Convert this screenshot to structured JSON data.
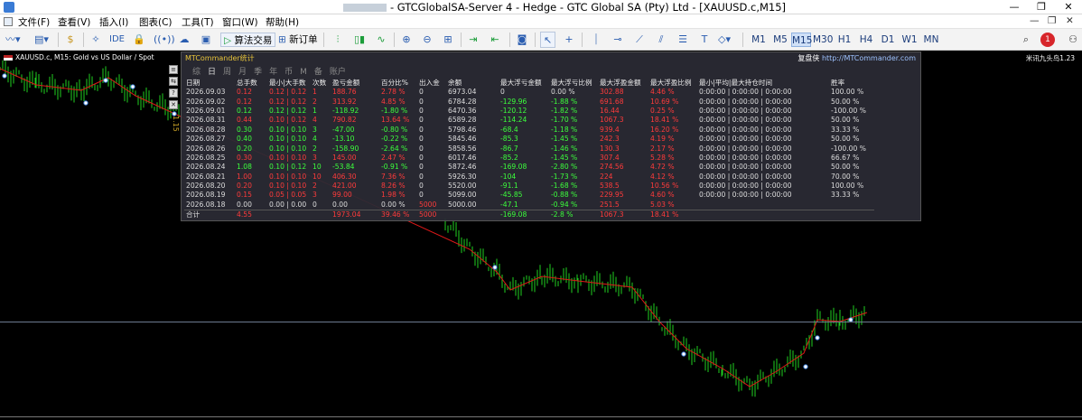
{
  "window": {
    "title": "- GTCGlobalSA-Server 4 - Hedge - GTC Global SA (Pty) Ltd - [XAUUSD.c,M15]",
    "minimize": "—",
    "restore": "❐",
    "close": "✕"
  },
  "menu": [
    {
      "name": "menu-file",
      "label": "文件(F)"
    },
    {
      "name": "menu-view",
      "label": "查看(V)"
    },
    {
      "name": "menu-insert",
      "label": "插入(I)"
    },
    {
      "name": "menu-charts",
      "label": "图表(C)"
    },
    {
      "name": "menu-tools",
      "label": "工具(T)"
    },
    {
      "name": "menu-window",
      "label": "窗口(W)"
    },
    {
      "name": "menu-help",
      "label": "帮助(H)"
    }
  ],
  "toolbar": {
    "ide": "IDE",
    "algo_trading": "算法交易",
    "new_order": "新订单",
    "timeframes": [
      "M1",
      "M5",
      "M15",
      "M30",
      "H1",
      "H4",
      "D1",
      "W1",
      "MN"
    ],
    "active_timeframe": "M15",
    "notification_count": "1"
  },
  "chart": {
    "header": "XAUUSD.c, M15:  Gold vs US Dollar / Spot",
    "right_label": "米讯九头鸟1.23",
    "price_tag": "1.15"
  },
  "colors": {
    "red": "#ff3b3b",
    "green": "#3cff3c",
    "panel_bg": "#2a2a34",
    "title_yellow": "#e8c53a",
    "candle_up": "#1fd01f",
    "ma_line": "#e01818"
  },
  "panel": {
    "title": "MTCommander统计",
    "link_label": "复盘侠",
    "link_url": "http://MTCommander.com",
    "periods": [
      "综",
      "日",
      "周",
      "月",
      "季",
      "年",
      "币",
      "M",
      "备",
      "账户"
    ],
    "selected_period": "日",
    "columns": [
      "日期",
      "总手数",
      "最小|大手数",
      "次数",
      "盈亏金额",
      "百分比%",
      "出入金",
      "余额",
      "最大浮亏金额",
      "最大浮亏比例",
      "最大浮盈金额",
      "最大浮盈比例",
      "最小|平均|最大持仓时间",
      "胜率"
    ],
    "rows": [
      {
        "cells": [
          "2026.09.03",
          "0.12",
          "0.12 | 0.12",
          "1",
          "188.76",
          "2.78 %",
          "0",
          "6973.04",
          "0",
          "0.00 %",
          "302.88",
          "4.46 %",
          "0:00:00 | 0:00:00 | 0:00:00",
          "100.00 %"
        ],
        "colors": [
          "",
          "red",
          "red",
          "red",
          "red",
          "red",
          "",
          "",
          "",
          "",
          "red",
          "red",
          "",
          ""
        ]
      },
      {
        "cells": [
          "2026.09.02",
          "0.12",
          "0.12 | 0.12",
          "2",
          "313.92",
          "4.85 %",
          "0",
          "6784.28",
          "-129.96",
          "-1.88 %",
          "691.68",
          "10.69 %",
          "0:00:00 | 0:00:00 | 0:00:00",
          "50.00 %"
        ],
        "colors": [
          "",
          "red",
          "red",
          "red",
          "red",
          "red",
          "",
          "",
          "green",
          "green",
          "red",
          "red",
          "",
          ""
        ]
      },
      {
        "cells": [
          "2026.09.01",
          "0.12",
          "0.12 | 0.12",
          "1",
          "-118.92",
          "-1.80 %",
          "0",
          "6470.36",
          "-120.12",
          "-1.82 %",
          "16.44",
          "0.25 %",
          "0:00:00 | 0:00:00 | 0:00:00",
          "-100.00 %"
        ],
        "colors": [
          "",
          "green",
          "green",
          "green",
          "green",
          "green",
          "",
          "",
          "green",
          "green",
          "red",
          "red",
          "",
          ""
        ]
      },
      {
        "cells": [
          "2026.08.31",
          "0.44",
          "0.10 | 0.12",
          "4",
          "790.82",
          "13.64 %",
          "0",
          "6589.28",
          "-114.24",
          "-1.70 %",
          "1067.3",
          "18.41 %",
          "0:00:00 | 0:00:00 | 0:00:00",
          "50.00 %"
        ],
        "colors": [
          "",
          "red",
          "red",
          "red",
          "red",
          "red",
          "",
          "",
          "green",
          "green",
          "red",
          "red",
          "",
          ""
        ]
      },
      {
        "cells": [
          "2026.08.28",
          "0.30",
          "0.10 | 0.10",
          "3",
          "-47.00",
          "-0.80 %",
          "0",
          "5798.46",
          "-68.4",
          "-1.18 %",
          "939.4",
          "16.20 %",
          "0:00:00 | 0:00:00 | 0:00:00",
          "33.33 %"
        ],
        "colors": [
          "",
          "green",
          "green",
          "green",
          "green",
          "green",
          "",
          "",
          "green",
          "green",
          "red",
          "red",
          "",
          ""
        ]
      },
      {
        "cells": [
          "2026.08.27",
          "0.40",
          "0.10 | 0.10",
          "4",
          "-13.10",
          "-0.22 %",
          "0",
          "5845.46",
          "-85.3",
          "-1.45 %",
          "242.3",
          "4.19 %",
          "0:00:00 | 0:00:00 | 0:00:00",
          "50.00 %"
        ],
        "colors": [
          "",
          "green",
          "green",
          "green",
          "green",
          "green",
          "",
          "",
          "green",
          "green",
          "red",
          "red",
          "",
          ""
        ]
      },
      {
        "cells": [
          "2026.08.26",
          "0.20",
          "0.10 | 0.10",
          "2",
          "-158.90",
          "-2.64 %",
          "0",
          "5858.56",
          "-86.7",
          "-1.46 %",
          "130.3",
          "2.17 %",
          "0:00:00 | 0:00:00 | 0:00:00",
          "-100.00 %"
        ],
        "colors": [
          "",
          "green",
          "green",
          "green",
          "green",
          "green",
          "",
          "",
          "green",
          "green",
          "red",
          "red",
          "",
          ""
        ]
      },
      {
        "cells": [
          "2026.08.25",
          "0.30",
          "0.10 | 0.10",
          "3",
          "145.00",
          "2.47 %",
          "0",
          "6017.46",
          "-85.2",
          "-1.45 %",
          "307.4",
          "5.28 %",
          "0:00:00 | 0:00:00 | 0:00:00",
          "66.67 %"
        ],
        "colors": [
          "",
          "red",
          "red",
          "red",
          "red",
          "red",
          "",
          "",
          "green",
          "green",
          "red",
          "red",
          "",
          ""
        ]
      },
      {
        "cells": [
          "2026.08.24",
          "1.08",
          "0.10 | 0.12",
          "10",
          "-53.84",
          "-0.91 %",
          "0",
          "5872.46",
          "-169.08",
          "-2.80 %",
          "274.56",
          "4.72 %",
          "0:00:00 | 0:00:00 | 0:00:00",
          "50.00 %"
        ],
        "colors": [
          "",
          "green",
          "green",
          "green",
          "green",
          "green",
          "",
          "",
          "green",
          "green",
          "red",
          "red",
          "",
          ""
        ]
      },
      {
        "cells": [
          "2026.08.21",
          "1.00",
          "0.10 | 0.10",
          "10",
          "406.30",
          "7.36 %",
          "0",
          "5926.30",
          "-104",
          "-1.73 %",
          "224",
          "4.12 %",
          "0:00:00 | 0:00:00 | 0:00:00",
          "70.00 %"
        ],
        "colors": [
          "",
          "red",
          "red",
          "red",
          "red",
          "red",
          "",
          "",
          "green",
          "green",
          "red",
          "red",
          "",
          ""
        ]
      },
      {
        "cells": [
          "2026.08.20",
          "0.20",
          "0.10 | 0.10",
          "2",
          "421.00",
          "8.26 %",
          "0",
          "5520.00",
          "-91.1",
          "-1.68 %",
          "538.5",
          "10.56 %",
          "0:00:00 | 0:00:00 | 0:00:00",
          "100.00 %"
        ],
        "colors": [
          "",
          "red",
          "red",
          "red",
          "red",
          "red",
          "",
          "",
          "green",
          "green",
          "red",
          "red",
          "",
          ""
        ]
      },
      {
        "cells": [
          "2026.08.19",
          "0.15",
          "0.05 | 0.05",
          "3",
          "99.00",
          "1.98 %",
          "0",
          "5099.00",
          "-45.85",
          "-0.88 %",
          "229.95",
          "4.60 %",
          "0:00:00 | 0:00:00 | 0:00:00",
          "33.33 %"
        ],
        "colors": [
          "",
          "red",
          "red",
          "red",
          "red",
          "red",
          "",
          "",
          "green",
          "green",
          "red",
          "red",
          "",
          ""
        ]
      },
      {
        "cells": [
          "2026.08.18",
          "0.00",
          "0.00 | 0.00",
          "0",
          "0.00",
          "0.00 %",
          "5000",
          "5000.00",
          "-47.1",
          "-0.94 %",
          "251.5",
          "5.03 %",
          "",
          ""
        ],
        "colors": [
          "",
          "",
          "",
          "",
          "",
          "",
          "red",
          "",
          "green",
          "green",
          "red",
          "red",
          "",
          ""
        ]
      }
    ],
    "total": {
      "cells": [
        "合计",
        "4.55",
        "",
        "",
        "1973.04",
        "39.46 %",
        "5000",
        "",
        "-169.08",
        "-2.8 %",
        "1067.3",
        "18.41 %",
        "",
        ""
      ],
      "colors": [
        "",
        "red",
        "",
        "",
        "red",
        "red",
        "red",
        "",
        "green",
        "green",
        "red",
        "red",
        "",
        ""
      ]
    }
  }
}
